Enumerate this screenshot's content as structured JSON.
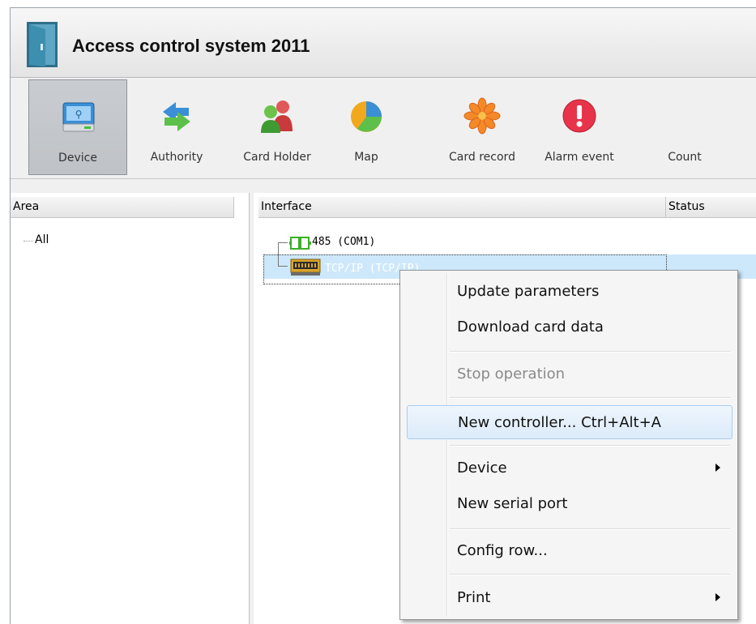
{
  "window": {
    "title": "Access control system 2011",
    "icon": "door-icon"
  },
  "toolbar": {
    "items": [
      {
        "label": "Device",
        "icon": "device-drive-icon",
        "active": true
      },
      {
        "label": "Authority",
        "icon": "sync-arrows-icon"
      },
      {
        "label": "Card Holder",
        "icon": "users-icon"
      },
      {
        "label": "Map",
        "icon": "pie-chart-icon"
      },
      {
        "label": "Card record",
        "icon": "asterisk-icon"
      },
      {
        "label": "Alarm event",
        "icon": "alert-icon"
      },
      {
        "label": "Count",
        "icon": ""
      }
    ]
  },
  "left_panel": {
    "header": "Area",
    "tree": [
      {
        "label": "All"
      }
    ]
  },
  "right_panel": {
    "columns": [
      "Interface",
      "Status"
    ],
    "nodes": [
      {
        "label": "485 (COM1)",
        "icon": "serial-port-icon"
      },
      {
        "label": "TCP/IP (TCP/IP)",
        "icon": "network-card-icon",
        "selected": true
      }
    ]
  },
  "context_menu": {
    "items": [
      {
        "label": "Update parameters"
      },
      {
        "label": "Download card data"
      },
      {
        "label": "Stop operation",
        "disabled": true
      },
      {
        "label": "New controller... Ctrl+Alt+A",
        "highlighted": true
      },
      {
        "label": "Device",
        "submenu": true
      },
      {
        "label": "New serial port"
      },
      {
        "label": "Config row..."
      },
      {
        "label": "Print",
        "submenu": true
      }
    ]
  },
  "colors": {
    "selection": "#cde8fb",
    "menu_hover": "#dcebfa",
    "toolbar_active": "#c4c7cb"
  }
}
